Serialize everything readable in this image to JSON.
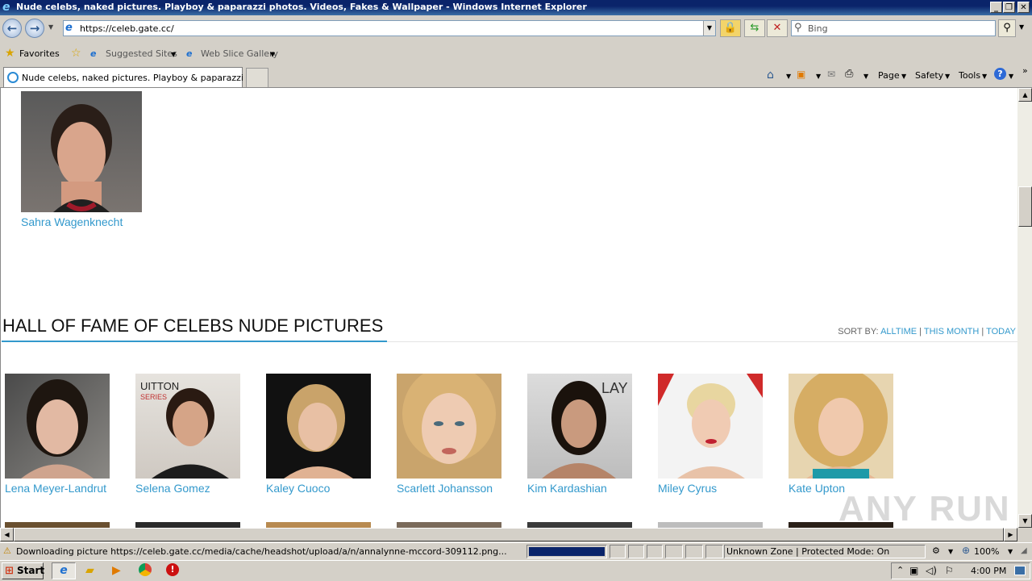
{
  "window": {
    "title": "Nude celebs, naked pictures. Playboy & paparazzi photos. Videos, Fakes & Wallpaper - Windows Internet Explorer"
  },
  "address": {
    "url": "https://celeb.gate.cc/"
  },
  "search": {
    "placeholder": "Bing"
  },
  "favorites": {
    "label": "Favorites",
    "suggested": "Suggested Sites",
    "webslice": "Web Slice Gallery"
  },
  "tab": {
    "label": "Nude celebs, naked pictures. Playboy & paparazzi ph..."
  },
  "commands": {
    "page": "Page",
    "safety": "Safety",
    "tools": "Tools"
  },
  "top_celeb": {
    "name": "Sahra Wagenknecht"
  },
  "hall_of_fame": {
    "title": "HALL OF FAME OF CELEBS NUDE PICTURES",
    "sort_label": "SORT BY:",
    "sort_alltime": "ALLTIME",
    "sort_month": "THIS MONTH",
    "sort_today": "TODAY",
    "sep": "|",
    "celebs": [
      {
        "name": "Lena Meyer-Landrut"
      },
      {
        "name": "Selena Gomez"
      },
      {
        "name": "Kaley Cuoco"
      },
      {
        "name": "Scarlett Johansson"
      },
      {
        "name": "Kim Kardashian"
      },
      {
        "name": "Miley Cyrus"
      },
      {
        "name": "Kate Upton"
      }
    ]
  },
  "status": {
    "text": "Downloading picture https://celeb.gate.cc/media/cache/headshot/upload/a/n/annalynne-mccord-309112.png...",
    "zone": "Unknown Zone | Protected Mode: On",
    "zoom": "100%",
    "progress": 1.0
  },
  "taskbar": {
    "start": "Start",
    "clock": "4:00 PM"
  },
  "watermark": "ANY RUN",
  "colors": {
    "link": "#3399cc",
    "titlebar": "#0a246a"
  }
}
